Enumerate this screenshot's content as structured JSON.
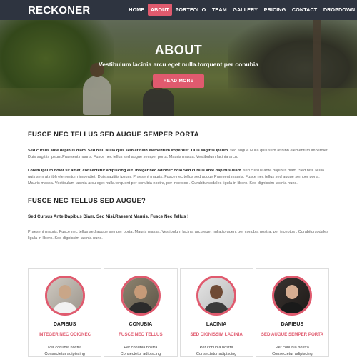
{
  "brand": "RECKONER",
  "colors": {
    "accent": "#e05a6e",
    "navbar": "#2e3440"
  },
  "nav": {
    "items": [
      "HOME",
      "ABOUT",
      "PORTFOLIO",
      "TEAM",
      "GALLERY",
      "PRICING",
      "CONTACT",
      "DROPDOWN"
    ],
    "active": "ABOUT",
    "dropdown_icon": "caret-down-icon"
  },
  "hero": {
    "title": "ABOUT",
    "subtitle": "Vestibulum lacinia arcu eget nulla.torquent per conubia",
    "button": "READ MORE"
  },
  "section1": {
    "heading": "FUSCE NEC TELLUS SED AUGUE SEMPER PORTA",
    "para1_bold": "Sed cursus ante dapibus diam. Sed nisi. Nulla quis sem at nibh elementum imperdiet. Duis sagittis ipsum.",
    "para1_rest": " sed augue Nulla quis sem at nibh elementum imperdiet. Duis sagittis ipsum.Praesent mauris. Fusce nec tellus sed augue semper porta. Mauris massa. Vestibulum lacinia arcu.",
    "para2_bold": "Lorem ipsum dolor sit amet, consectetur adipiscing elit. Integer nec odionec odio.Sed cursus ante dapibus diam.",
    "para2_rest": " sed cursus ante dapibus diam. Sed nisi. Nulla quis sem at nibh elementum imperdiet. Duis sagittis ipsum. Praesent mauris. Fusce nec tellus sed augue Praesent mauris. Fusce nec tellus sed augue semper porta. Mauris massa. Vestibulum lacinia arcu eget nulla.torquent per conubia nostra, per inceptos . Curabitursodales ligula in libero. Sed dignissim lacinia nunc."
  },
  "section2": {
    "heading": "FUSCE NEC TELLUS SED AUGUE?",
    "lead": "Sed Cursus Ante Dapibus Diam. Sed Nisi.Raesent Mauris. Fusce Nec Tellus !",
    "para": "Praesent mauris. Fusce nec tellus sed augue semper porta. Mauris massa. Vestibulum lacinia arcu eget nulla.torquent per conubia nostra, per inceptos . Curabitursodales ligula in libero. Sed dignissim lacinia nunc."
  },
  "cards": [
    {
      "name": "DAPIBUS",
      "role": "INTEGER NEC ODIONEC",
      "desc1": "Per conubia nostra",
      "desc2": "Consectetur adipiscing"
    },
    {
      "name": "CONUBIA",
      "role": "FUSCE NEC TELLUS",
      "desc1": "Per conubia nostra",
      "desc2": "Consectetur adipiscing"
    },
    {
      "name": "LACINIA",
      "role": "SED DIGNISSIM LACINIA",
      "desc1": "Per conubia nostra",
      "desc2": "Consectetur adipiscing"
    },
    {
      "name": "DAPIBUS",
      "role": "SED AUGUE SEMPER PORTA",
      "desc1": "Per conubia nostra",
      "desc2": "Consectetur adipiscing"
    }
  ]
}
